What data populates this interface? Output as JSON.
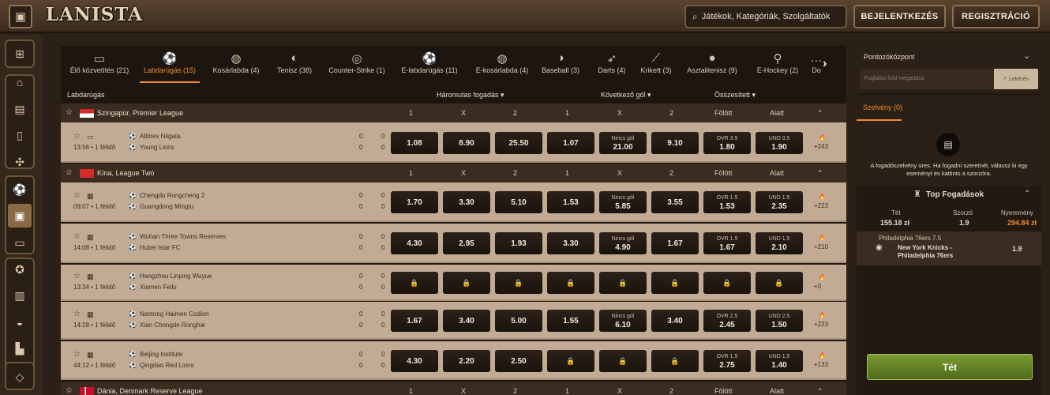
{
  "header": {
    "menu_icon": "sidebar-toggle-icon",
    "logo": "LANISTA",
    "search_placeholder": "Játékok, Kategóriák, Szolgáltatók",
    "login": "BEJELENTKEZÉS",
    "register": "REGISZTRÁCIÓ"
  },
  "sidebar": {
    "icons": [
      "gift-icon",
      "home-icon",
      "calendar-icon",
      "cards-icon",
      "poker-chip-icon",
      "soccer-ball-icon",
      "ticket-icon",
      "screen-icon",
      "medal-icon",
      "podium-icon",
      "helmet-icon",
      "briefcase-icon",
      "diamond-icon"
    ]
  },
  "tabs": [
    {
      "label": "Élő közvetítés (21)",
      "icon": "tv-icon"
    },
    {
      "label": "Labdarúgás (15)",
      "icon": "soccer-ball-icon",
      "active": true
    },
    {
      "label": "Kosárlabda (4)",
      "icon": "basketball-icon"
    },
    {
      "label": "Tenisz (38)",
      "icon": "tennis-ball-icon"
    },
    {
      "label": "Counter-Strike (1)",
      "icon": "crosshair-icon"
    },
    {
      "label": "E-labdarúgás (11)",
      "icon": "e-soccer-icon"
    },
    {
      "label": "E-kosárlabda (4)",
      "icon": "e-basketball-icon"
    },
    {
      "label": "Baseball (3)",
      "icon": "baseball-icon"
    },
    {
      "label": "Darts (4)",
      "icon": "darts-icon"
    },
    {
      "label": "Krikett (3)",
      "icon": "cricket-bat-icon"
    },
    {
      "label": "Asztalitenisz (9)",
      "icon": "table-tennis-icon"
    },
    {
      "label": "E-Hockey (2)",
      "icon": "hockey-icon"
    },
    {
      "label": "Do",
      "icon": "more-icon"
    }
  ],
  "market_header": {
    "sport": "Labdarúgás",
    "m1": "Háromutas fogadás",
    "m2": "Következő gól",
    "m3": "Összesített"
  },
  "cols": {
    "c1": "1",
    "cx": "X",
    "c2": "2",
    "over": "Fölött",
    "under": "Alatt"
  },
  "leagues": [
    {
      "name": "Szingapúr, Premier League",
      "flag": "sg"
    },
    {
      "name": "Kína, League Two",
      "flag": "cn"
    },
    {
      "name": "Dánia, Denmark Reserve League",
      "flag": "dk"
    }
  ],
  "matches": [
    {
      "time": "13:56 • 1 félidő",
      "home": "Albirex Niigata",
      "away": "Young Lions",
      "hs1": "0",
      "hs2": "0",
      "as1": "0",
      "as2": "0",
      "o": [
        "1.08",
        "8.90",
        "25.50",
        "1.07",
        "21.00",
        "9.10",
        "1.80",
        "1.90"
      ],
      "ng": "Nincs gól",
      "ovr": "OVR 3.5",
      "und": "UND 3.5",
      "more": "+243"
    },
    {
      "time": "09:07 • 1 félidő",
      "home": "Chengdu Rongcheng 2",
      "away": "Guangdong Mingtu",
      "hs1": "0",
      "hs2": "0",
      "as1": "0",
      "as2": "0",
      "o": [
        "1.70",
        "3.30",
        "5.10",
        "1.53",
        "5.85",
        "3.55",
        "1.53",
        "2.35"
      ],
      "ng": "Nincs gól",
      "ovr": "OVR 1.5",
      "und": "UND 1.5",
      "more": "+223"
    },
    {
      "time": "14:08 • 1 félidő",
      "home": "Wuhan Three Towns Reserves",
      "away": "Hubei Istar FC",
      "hs1": "0",
      "hs2": "0",
      "as1": "0",
      "as2": "0",
      "o": [
        "4.30",
        "2.95",
        "1.93",
        "3.30",
        "4.90",
        "1.67",
        "1.67",
        "2.10"
      ],
      "ng": "Nincs gól",
      "ovr": "OVR 1.5",
      "und": "UND 1.5",
      "more": "+210"
    },
    {
      "time": "13:34 • 1 félidő",
      "home": "Hangzhou Linping Wuyue",
      "away": "Xiamen Feilu",
      "hs1": "0",
      "hs2": "0",
      "as1": "0",
      "as2": "0",
      "more": "+0"
    },
    {
      "time": "14:28 • 1 félidő",
      "home": "Nantong Haimen Codion",
      "away": "Xian Chongde Ronghai",
      "hs1": "0",
      "hs2": "0",
      "as1": "0",
      "as2": "0",
      "o": [
        "1.67",
        "3.40",
        "5.00",
        "1.55",
        "6.10",
        "3.40",
        "2.45",
        "1.50"
      ],
      "ng": "Nincs gól",
      "ovr": "OVR 2.5",
      "und": "UND 2.5",
      "more": "+223"
    },
    {
      "time": "44:12 • 1 félidő",
      "home": "Beijing Institute",
      "away": "Qingdao Red Lions",
      "hs1": "0",
      "hs2": "0",
      "as1": "0",
      "as2": "0",
      "o": [
        "4.30",
        "2.20",
        "2.50",
        "2.75",
        "1.40"
      ],
      "ovr": "OVR 1.5",
      "und": "UND 1.5",
      "more": "+133"
    }
  ],
  "right": {
    "points_title": "Pontozóközpont",
    "code_placeholder": "Foglalási kód megadása",
    "code_button": "Lekérés",
    "slip_tab": "Szelvény (0)",
    "slip_empty": "A fogadószelvény üres. Ha fogadni szeretnél, válassz ki egy eseményt és kattints a szorzóra.",
    "top_bets_title": "Top Fogadások",
    "stake_label": "Tét",
    "stake": "155.18 zł",
    "mult_label": "Szorzó",
    "mult": "1.9",
    "win_label": "Nyeremény",
    "win": "294.84 zł",
    "bet_market": "Philadelphia 76ers 7.5",
    "bet_match": "New York Knicks - Philadelphia 76ers",
    "bet_odd": "1.9",
    "place_button": "Tét"
  }
}
